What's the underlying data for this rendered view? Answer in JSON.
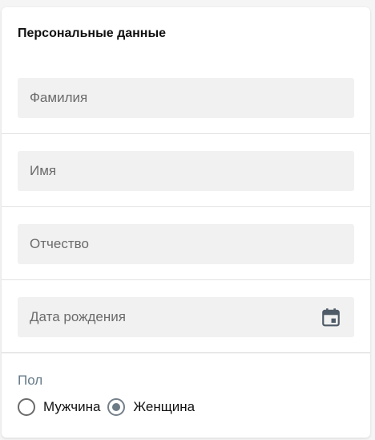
{
  "form": {
    "title": "Персональные данные",
    "fields": {
      "last_name": {
        "placeholder": "Фамилия",
        "value": ""
      },
      "first_name": {
        "placeholder": "Имя",
        "value": ""
      },
      "middle_name": {
        "placeholder": "Отчество",
        "value": ""
      },
      "birth_date": {
        "placeholder": "Дата рождения",
        "value": "",
        "icon": "calendar-icon"
      }
    },
    "gender": {
      "label": "Пол",
      "options": [
        {
          "label": "Мужчина",
          "selected": false
        },
        {
          "label": "Женщина",
          "selected": true
        }
      ]
    }
  },
  "colors": {
    "field_background": "#f1f1f1",
    "radio_selected": "#6d7b86",
    "gender_label": "#667b8a"
  }
}
